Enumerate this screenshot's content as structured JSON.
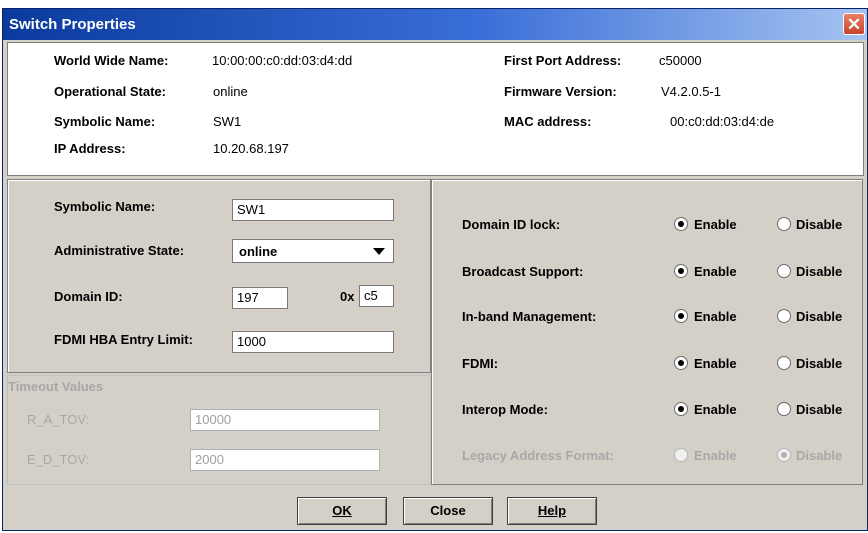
{
  "window": {
    "title": "Switch Properties",
    "close_glyph": "✕"
  },
  "info": {
    "wwn_label": "World Wide Name:",
    "wwn_value": "10:00:00:c0:dd:03:d4:dd",
    "opstate_label": "Operational State:",
    "opstate_value": "online",
    "symname_label": "Symbolic Name:",
    "symname_value": "SW1",
    "ip_label": "IP Address:",
    "ip_value": "10.20.68.197",
    "fpa_label": "First Port Address:",
    "fpa_value": "c50000",
    "fw_label": "Firmware Version:",
    "fw_value": "V4.2.0.5-1",
    "mac_label": "MAC address:",
    "mac_value": "00:c0:dd:03:d4:de"
  },
  "form": {
    "symname_label": "Symbolic Name:",
    "symname_value": "SW1",
    "admin_label": "Administrative State:",
    "admin_value": "online",
    "domain_label": "Domain ID:",
    "domain_value": "197",
    "hex_prefix": "0x",
    "hex_value": "c5",
    "fdmi_label": "FDMI HBA Entry Limit:",
    "fdmi_value": "1000"
  },
  "timeout": {
    "legend": "Timeout Values",
    "ratov_label": "R_A_TOV:",
    "ratov_value": "10000",
    "edtov_label": "E_D_TOV:",
    "edtov_value": "2000"
  },
  "options": {
    "enable_label": "Enable",
    "disable_label": "Disable",
    "rows": [
      {
        "label": "Domain ID lock:",
        "selected": "enable",
        "disabled": false
      },
      {
        "label": "Broadcast Support:",
        "selected": "enable",
        "disabled": false
      },
      {
        "label": "In-band Management:",
        "selected": "enable",
        "disabled": false
      },
      {
        "label": "FDMI:",
        "selected": "enable",
        "disabled": false
      },
      {
        "label": "Interop Mode:",
        "selected": "enable",
        "disabled": false
      },
      {
        "label": "Legacy Address Format:",
        "selected": "disable",
        "disabled": true
      }
    ]
  },
  "buttons": {
    "ok_label": "OK",
    "close_label": "Close",
    "help_label": "Help"
  }
}
